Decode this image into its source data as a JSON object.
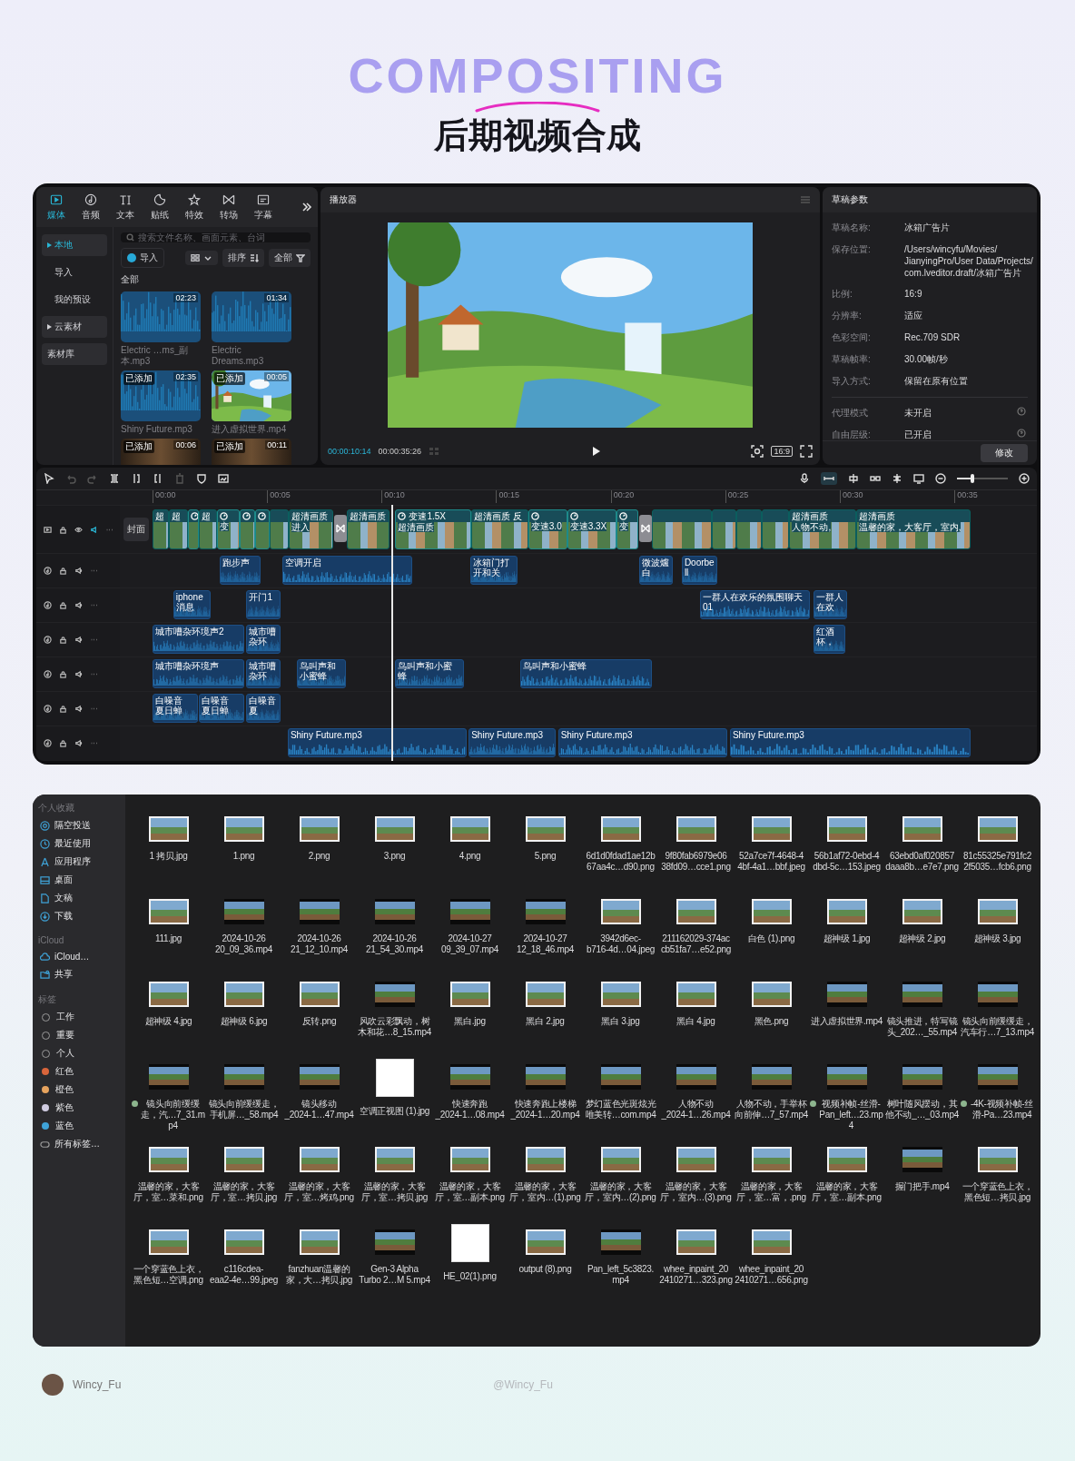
{
  "header": {
    "backdrop_word": "COMPOSITING",
    "title": "后期视频合成"
  },
  "editor": {
    "media_panel": {
      "tabs": [
        {
          "label": "媒体",
          "kind": "media",
          "selected": true
        },
        {
          "label": "音频",
          "kind": "audio",
          "selected": false
        },
        {
          "label": "文本",
          "kind": "text",
          "selected": false
        },
        {
          "label": "贴纸",
          "kind": "sticker",
          "selected": false
        },
        {
          "label": "特效",
          "kind": "effect",
          "selected": false
        },
        {
          "label": "转场",
          "kind": "transition",
          "selected": false
        },
        {
          "label": "字幕",
          "kind": "caption",
          "selected": false
        }
      ],
      "nav": [
        {
          "label": "本地",
          "kind": "folder",
          "selected": true
        },
        {
          "label": "导入",
          "kind": "plain",
          "selected": false
        },
        {
          "label": "我的预设",
          "kind": "plain",
          "selected": false
        },
        {
          "label": "云素材",
          "kind": "folder",
          "selected": false
        },
        {
          "label": "素材库",
          "kind": "button",
          "selected": false
        }
      ],
      "search": {
        "placeholder": "搜索文件名称、画面元素、台词"
      },
      "import_button": "导入",
      "sort_button": "排序",
      "filter_button": "全部",
      "section": "全部",
      "items": [
        {
          "kind": "audio",
          "name": "Electric …ms_副本.mp3",
          "duration": "02:23"
        },
        {
          "kind": "audio",
          "name": "Electric Dreams.mp3",
          "duration": "01:34"
        },
        {
          "kind": "audio",
          "name": "Shiny Future.mp3",
          "duration": "02:35",
          "badge": "已添加"
        },
        {
          "kind": "video",
          "name": "进入虚拟世界.mp4",
          "duration": "00:05",
          "badge": "已添加"
        },
        {
          "kind": "clip",
          "duration": "00:06",
          "badge": "已添加"
        },
        {
          "kind": "clip",
          "duration": "00:11",
          "badge": "已添加"
        }
      ]
    },
    "player": {
      "title": "播放器",
      "current_time": "00:00:10:14",
      "total_time": "00:00:35:26",
      "ratio": "16:9"
    },
    "draft": {
      "title": "草稿参数",
      "fields": [
        {
          "label": "草稿名称:",
          "value": "冰箱广告片"
        },
        {
          "label": "保存位置:",
          "value": "/Users/wincyfu/Movies/\nJianyingPro/User Data/Projects/\ncom.lveditor.draft/冰箱广告片"
        },
        {
          "label": "比例:",
          "value": "16:9"
        },
        {
          "label": "分辨率:",
          "value": "适应"
        },
        {
          "label": "色彩空间:",
          "value": "Rec.709 SDR"
        },
        {
          "label": "草稿帧率:",
          "value": "30.00帧/秒"
        },
        {
          "label": "导入方式:",
          "value": "保留在原有位置"
        }
      ],
      "settings": [
        {
          "label": "代理模式",
          "value": "未开启"
        },
        {
          "label": "自由层级:",
          "value": "已开启"
        }
      ],
      "button": "修改"
    }
  },
  "timeline": {
    "ruler": [
      "00:00",
      "00:05",
      "00:10",
      "00:15",
      "00:20",
      "00:25",
      "00:30",
      "00:35"
    ],
    "zoom_slider": {
      "level": 0.3
    },
    "cover_label": "封面",
    "video_clips": [
      {
        "tags": [
          "超"
        ],
        "speed": false,
        "transition_after": false
      },
      {
        "tags": [
          "超"
        ],
        "speed": false,
        "transition_after": false
      },
      {
        "speed": true,
        "transition_after": false
      },
      {
        "tags": [
          "超"
        ],
        "speed": false,
        "transition_after": false
      },
      {
        "tags": [
          "变"
        ],
        "speed": true,
        "transition_after": false
      },
      {
        "speed": true,
        "transition_after": false
      },
      {
        "speed": true,
        "transition_after": false
      },
      {
        "speed": false,
        "transition_after": false
      },
      {
        "tags": [
          "超清画质",
          "进入"
        ],
        "speed": false,
        "transition_after": true
      },
      {
        "tags": [
          "超清画质"
        ],
        "speed": false,
        "transition_after": false
      },
      {
        "tags": [
          "变速1.5X",
          "超清画质"
        ],
        "speed": true,
        "transition_after": false
      },
      {
        "tags": [
          "超清画质",
          "反"
        ],
        "speed": false,
        "transition_after": false
      },
      {
        "tags": [
          "变速3.0"
        ],
        "speed": true,
        "transition_after": false
      },
      {
        "tags": [
          "变速3.3X"
        ],
        "speed": true,
        "transition_after": false
      },
      {
        "tags": [
          "变"
        ],
        "speed": true,
        "transition_after": true
      },
      {
        "speed": false,
        "transition_after": false
      },
      {
        "speed": false,
        "transition_after": false
      },
      {
        "speed": false,
        "transition_after": false
      },
      {
        "speed": false,
        "transition_after": false
      },
      {
        "tags": [
          "超清画质",
          "人物不动,"
        ],
        "speed": false,
        "transition_after": false
      },
      {
        "tags": [
          "超清画质",
          "温馨的家，大客厅，室内,"
        ],
        "speed": false,
        "transition_after": false
      }
    ],
    "audio_tracks": [
      {
        "clips": [
          {
            "labels": [
              "跑步声"
            ]
          },
          {
            "labels": [
              "空调开启"
            ]
          },
          {
            "labels": [
              "冰箱门打开和关"
            ]
          },
          {
            "labels": [
              "微波爐",
              "白"
            ]
          },
          {
            "labels": [
              "Doorbell"
            ]
          }
        ]
      },
      {
        "clips": [
          {
            "labels": [
              "iphone消息"
            ]
          },
          {
            "labels": [
              "开门1"
            ]
          },
          {
            "labels": [
              "一群人在欢乐的氛围聊天01"
            ]
          },
          {
            "labels": [
              "一群人在欢"
            ]
          }
        ]
      },
      {
        "clips": [
          {
            "labels": [
              "城市嘈杂环境声2"
            ]
          },
          {
            "labels": [
              "城市嘈杂环"
            ]
          },
          {
            "labels": [
              "红酒杯，"
            ]
          }
        ]
      },
      {
        "clips": [
          {
            "labels": [
              "城市嘈杂环境声"
            ]
          },
          {
            "labels": [
              "城市嘈杂环"
            ]
          },
          {
            "labels": [
              "鸟叫声和小蜜蜂"
            ]
          },
          {
            "labels": [
              "鸟叫声和小蜜蜂"
            ]
          },
          {
            "labels": [
              "鸟叫声和小蜜蜂"
            ]
          }
        ]
      },
      {
        "clips": [
          {
            "labels": [
              "白噪音",
              "夏日蝉"
            ]
          },
          {
            "labels": [
              "白噪音",
              "夏日蝉"
            ]
          },
          {
            "labels": [
              "白噪音",
              "夏"
            ]
          }
        ]
      },
      {
        "clips": [
          {
            "labels": [
              "Shiny Future.mp3"
            ]
          },
          {
            "labels": [
              "Shiny Future.mp3"
            ]
          },
          {
            "labels": [
              "Shiny Future.mp3"
            ]
          },
          {
            "labels": [
              "Shiny Future.mp3"
            ]
          }
        ]
      }
    ]
  },
  "files": {
    "sidebar": [
      {
        "title": "个人收藏",
        "items": [
          {
            "label": "隔空投送",
            "kind": "airdrop"
          },
          {
            "label": "最近使用",
            "kind": "recent"
          },
          {
            "label": "应用程序",
            "kind": "apps"
          },
          {
            "label": "桌面",
            "kind": "desktop"
          },
          {
            "label": "文稿",
            "kind": "documents"
          },
          {
            "label": "下载",
            "kind": "downloads"
          }
        ]
      },
      {
        "title": "iCloud",
        "items": [
          {
            "label": "iCloud…",
            "kind": "cloud"
          },
          {
            "label": "共享",
            "kind": "shared"
          }
        ]
      },
      {
        "title": "标签",
        "items": [
          {
            "label": "工作",
            "kind": "tag"
          },
          {
            "label": "重要",
            "kind": "tag"
          },
          {
            "label": "个人",
            "kind": "tag"
          },
          {
            "label": "红色",
            "kind": "tag",
            "color": "#d9653b"
          },
          {
            "label": "橙色",
            "kind": "tag",
            "color": "#e6a35e"
          },
          {
            "label": "紫色",
            "kind": "tag",
            "color": "#cfcbe0"
          },
          {
            "label": "蓝色",
            "kind": "tag",
            "color": "#3fa3d8"
          },
          {
            "label": "所有标签…",
            "kind": "all-tags"
          }
        ]
      }
    ],
    "items": [
      {
        "name": "1 拷贝.jpg",
        "kind": "image"
      },
      {
        "name": "1.png",
        "kind": "image"
      },
      {
        "name": "2.png",
        "kind": "image"
      },
      {
        "name": "3.png",
        "kind": "image"
      },
      {
        "name": "4.png",
        "kind": "image"
      },
      {
        "name": "5.png",
        "kind": "image"
      },
      {
        "name": "6d1d0fdad1ae12b\n67aa4c…d90.png",
        "kind": "image"
      },
      {
        "name": "9f80fab6979e06\n38fd09…cce1.png",
        "kind": "image"
      },
      {
        "name": "52a7ce7f-4648-4\n4bf-4a1…bbf.jpeg",
        "kind": "image"
      },
      {
        "name": "56b1af72-0ebd-4\ndbd-5c…153.jpeg",
        "kind": "image"
      },
      {
        "name": "63ebd0af020857\ndaaa8b…e7e7.png",
        "kind": "image"
      },
      {
        "name": "81c55325e791fc2\n2f5035…fcb6.png",
        "kind": "image"
      },
      {
        "name": "111.jpg",
        "kind": "image"
      },
      {
        "name": "2024-10-26\n20_09_36.mp4",
        "kind": "video"
      },
      {
        "name": "2024-10-26\n21_12_10.mp4",
        "kind": "video"
      },
      {
        "name": "2024-10-26\n21_54_30.mp4",
        "kind": "video"
      },
      {
        "name": "2024-10-27\n09_39_07.mp4",
        "kind": "video"
      },
      {
        "name": "2024-10-27\n12_18_46.mp4",
        "kind": "video"
      },
      {
        "name": "3942d6ec-\nb716-4d…04.jpeg",
        "kind": "image"
      },
      {
        "name": "211162029-374ac\ncb51fa7…e52.png",
        "kind": "image"
      },
      {
        "name": "白色 (1).png",
        "kind": "image"
      },
      {
        "name": "超神级 1.jpg",
        "kind": "image"
      },
      {
        "name": "超神级 2.jpg",
        "kind": "image"
      },
      {
        "name": "超神级 3.jpg",
        "kind": "image"
      },
      {
        "name": "超神级 4.jpg",
        "kind": "image"
      },
      {
        "name": "超神级 6.jpg",
        "kind": "image"
      },
      {
        "name": "反转.png",
        "kind": "image"
      },
      {
        "name": "风吹云彩飘动，树木和花…8_15.mp4",
        "kind": "video"
      },
      {
        "name": "黑白.jpg",
        "kind": "image"
      },
      {
        "name": "黑白 2.jpg",
        "kind": "image"
      },
      {
        "name": "黑白 3.jpg",
        "kind": "image"
      },
      {
        "name": "黑白 4.jpg",
        "kind": "image"
      },
      {
        "name": "黑色.png",
        "kind": "image"
      },
      {
        "name": "进入虚拟世界.mp4",
        "kind": "video"
      },
      {
        "name": "镜头推进，特写镜头_202…_55.mp4",
        "kind": "video"
      },
      {
        "name": "镜头向前缓缓走，汽车行…7_13.mp4",
        "kind": "video"
      },
      {
        "name": "镜头向前缓缓走，汽…7_31.mp4",
        "kind": "video",
        "color": "#8db58e"
      },
      {
        "name": "镜头向前缓缓走，手机屏…_58.mp4",
        "kind": "video"
      },
      {
        "name": "镜头移动\n_2024-1…47.mp4",
        "kind": "video"
      },
      {
        "name": "空调正视图 (1).jpg",
        "kind": "blank"
      },
      {
        "name": "快速奔跑\n_2024-1…08.mp4",
        "kind": "video"
      },
      {
        "name": "快速奔跑上楼梯\n_2024-1…20.mp4",
        "kind": "video"
      },
      {
        "name": "梦幻蓝色光斑炫光唯美转…com.mp4",
        "kind": "video"
      },
      {
        "name": "人物不动\n_2024-1…26.mp4",
        "kind": "video"
      },
      {
        "name": "人物不动，手举杯向前伸…7_57.mp4",
        "kind": "video"
      },
      {
        "name": "视频补帧-丝滑-\nPan_left…23.mp4",
        "kind": "video",
        "color": "#8db58e"
      },
      {
        "name": "树叶随风摆动，其他不动_…_03.mp4",
        "kind": "video"
      },
      {
        "name": "-4K-视频补帧-丝滑-Pa…23.mp4",
        "kind": "video",
        "color": "#8db58e"
      },
      {
        "name": "温馨的家，大客厅，室…菜和.png",
        "kind": "image"
      },
      {
        "name": "温馨的家，大客厅，室…拷贝.jpg",
        "kind": "image"
      },
      {
        "name": "温馨的家，大客厅，室…烤鸡.png",
        "kind": "image"
      },
      {
        "name": "温馨的家，大客厅，室…拷贝.jpg",
        "kind": "image"
      },
      {
        "name": "温馨的家，大客厅，室…副本.png",
        "kind": "image"
      },
      {
        "name": "温馨的家，大客厅，室内…(1).png",
        "kind": "image"
      },
      {
        "name": "温馨的家，大客厅，室内…(2).png",
        "kind": "image"
      },
      {
        "name": "温馨的家，大客厅，室内…(3).png",
        "kind": "image"
      },
      {
        "name": "温馨的家，大客厅，室…富，.png",
        "kind": "image"
      },
      {
        "name": "温馨的家，大客厅，室…副本.png",
        "kind": "image"
      },
      {
        "name": "握门把手.mp4",
        "kind": "video"
      },
      {
        "name": "一个穿蓝色上衣，黑色短…拷贝.jpg",
        "kind": "image"
      },
      {
        "name": "一个穿蓝色上衣，黑色短…空调.png",
        "kind": "image"
      },
      {
        "name": "c116cdea-\neaa2-4e…99.jpeg",
        "kind": "image"
      },
      {
        "name": "fanzhuan温馨的家，大…拷贝.jpg",
        "kind": "image"
      },
      {
        "name": "Gen-3 Alpha\nTurbo 2…M 5.mp4",
        "kind": "video"
      },
      {
        "name": "HE_02(1).png",
        "kind": "blank"
      },
      {
        "name": "output (8).png",
        "kind": "image"
      },
      {
        "name": "Pan_left_5c3823.\nmp4",
        "kind": "video"
      },
      {
        "name": "whee_inpaint_20\n2410271…323.png",
        "kind": "image"
      },
      {
        "name": "whee_inpaint_20\n2410271…656.png",
        "kind": "image"
      }
    ]
  },
  "footer": {
    "author": "Wincy_Fu",
    "handle": "@Wincy_Fu"
  }
}
